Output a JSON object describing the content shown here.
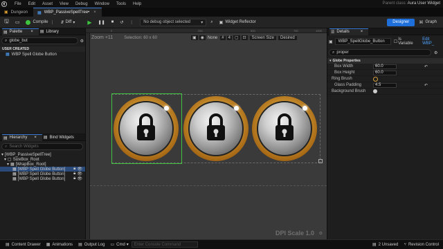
{
  "menubar": {
    "items": [
      "File",
      "Edit",
      "Asset",
      "View",
      "Debug",
      "Window",
      "Tools",
      "Help"
    ],
    "parent_class_label": "Parent class:",
    "parent_class_value": "Aura User Widget"
  },
  "tabs": [
    {
      "label": "Dungeon"
    },
    {
      "label": "WBP_PassiveSpellTree•"
    }
  ],
  "toolbar": {
    "compile": "Compile",
    "diff": "Diff",
    "debug_object": "No debug object selected",
    "widget_reflector": "Widget Reflector",
    "designer": "Designer",
    "graph": "Graph"
  },
  "palette": {
    "tab_palette": "Palette",
    "tab_library": "Library",
    "search_value": "globe_but",
    "category": "USER CREATED",
    "items": [
      "WBP Spell Globe Button"
    ]
  },
  "hierarchy": {
    "tab_hierarchy": "Hierarchy",
    "tab_bind": "Bind Widgets",
    "search_placeholder": "Search Widgets",
    "items": [
      {
        "label": "[WBP_PassiveSpellTree]",
        "depth": 0
      },
      {
        "label": "SizeBox_Root",
        "depth": 1
      },
      {
        "label": "[WrapBox_Root]",
        "depth": 2
      },
      {
        "label": "[WBP Spell Globe Button]",
        "depth": 3,
        "selected": true
      },
      {
        "label": "[WBP Spell Globe Button]",
        "depth": 3
      },
      {
        "label": "[WBP Spell Globe Button]",
        "depth": 3
      }
    ]
  },
  "canvas": {
    "zoom": "Zoom +11",
    "selection": "Selection: 60 x 60",
    "ruler_ticks": [
      "0",
      "250",
      "500",
      "750",
      "1000"
    ],
    "none_label": "None",
    "grid_size": "4",
    "screen_size": "Screen Size",
    "desired": "Desired",
    "dpi_scale": "DPI Scale 1.0"
  },
  "details": {
    "tab": "Details",
    "widget_name": "WBP_SpellGlobe_Button",
    "is_variable": "Is Variable",
    "edit_link": "Edit WBP_",
    "search_value": "proper",
    "category": "Globe Properties",
    "props": [
      {
        "label": "Box Width",
        "value": "60.0"
      },
      {
        "label": "Box Height",
        "value": "60.0"
      },
      {
        "label": "Ring Brush",
        "value": ""
      },
      {
        "label": "Glass Padding",
        "value": "4.5"
      },
      {
        "label": "Background Brush",
        "value": ""
      }
    ]
  },
  "statusbar": {
    "content_drawer": "Content Drawer",
    "animations": "Animations",
    "output_log": "Output Log",
    "cmd": "Cmd",
    "cmd_placeholder": "Enter Console Command",
    "unsaved": "2 Unsaved",
    "revision_control": "Revision Control"
  },
  "colors": {
    "accent": "#1e6fd9",
    "selection_green": "#3ec43e",
    "ring_gold": "#d8a23c"
  }
}
